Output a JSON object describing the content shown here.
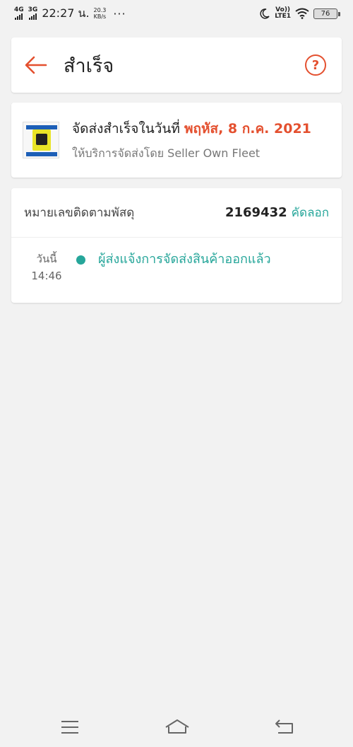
{
  "status_bar": {
    "network1": "4G",
    "network2": "3G",
    "time": "22:27 น.",
    "speed_value": "20.3",
    "speed_unit": "KB/s",
    "more": "···",
    "volte_top": "Vo))",
    "volte_bottom": "LTE1",
    "battery": "76"
  },
  "header": {
    "title": "สำเร็จ",
    "help": "?"
  },
  "shipment": {
    "status_prefix": "จัดส่งสำเร็จในวันที่ ",
    "delivered_date": "พฤหัส, 8 ก.ค. 2021",
    "service_line": "ให้บริการจัดส่งโดย Seller Own Fleet"
  },
  "tracking": {
    "label": "หมายเลขติดตามพัสดุ",
    "number": "2169432",
    "copy_label": "คัดลอก",
    "events": [
      {
        "day": "วันนี้",
        "time": "14:46",
        "text": "ผู้ส่งแจ้งการจัดส่งสินค้าออกแล้ว"
      }
    ]
  },
  "colors": {
    "accent": "#e4502f",
    "teal": "#26a69a",
    "background": "#f2f2f2"
  }
}
